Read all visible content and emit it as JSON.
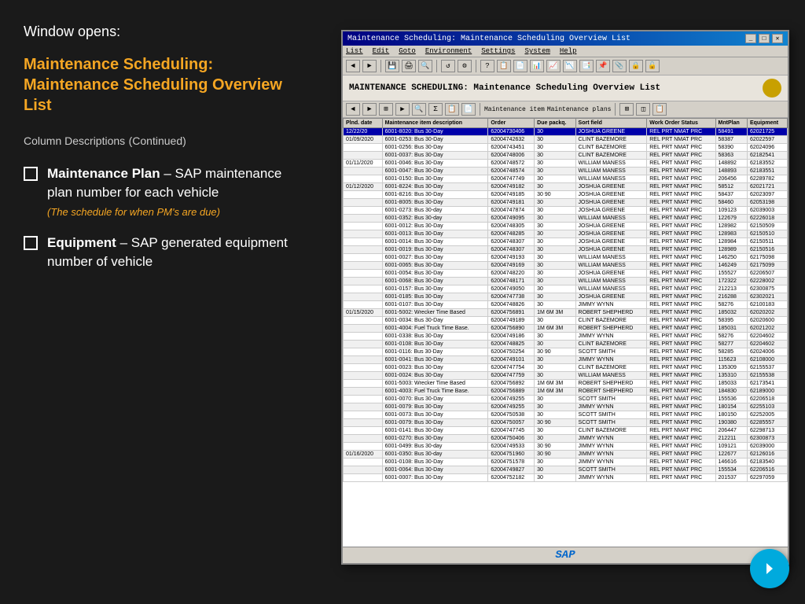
{
  "left": {
    "window_opens": "Window opens:",
    "main_title": "Maintenance Scheduling: Maintenance Scheduling Overview List",
    "column_desc": "Column Descriptions",
    "continued": "(Continued)",
    "bullets": [
      {
        "label": "Maintenance Plan",
        "desc": "SAP maintenance plan number for each vehicle",
        "sub_note": "(The schedule for when PM's are due)"
      },
      {
        "label": "Equipment",
        "desc": "SAP generated equipment number of vehicle",
        "sub_note": ""
      }
    ]
  },
  "sap": {
    "title": "Maintenance Scheduling: Maintenance Scheduling Overview List",
    "menu": [
      "List",
      "Edit",
      "Goto",
      "Environment",
      "Settings",
      "System",
      "Help"
    ],
    "content_title": "MAINTENANCE SCHEDULING: Maintenance Scheduling Overview List",
    "sub_toolbar_labels": [
      "Maintenance item",
      "Maintenance plans"
    ],
    "table_headers": [
      "Plnd. date",
      "Maintenance item description",
      "Order",
      "Due packq.",
      "Sort field",
      "Work Order Status",
      "MntPlan",
      "Equipment"
    ],
    "rows": [
      {
        "date": "12/22/20",
        "item": "6001-8020: Bus 30-Day",
        "order": "62004730406",
        "due": "30",
        "sort": "JOSHUA GREENE",
        "status": "REL PRT NMAT PRC",
        "plan": "58491",
        "equip": "62021725",
        "highlight": true
      },
      {
        "date": "01/09/2020",
        "item": "6001-0253: Bus 30-Day",
        "order": "62004742632",
        "due": "30",
        "sort": "CLINT BAZEMORE",
        "status": "REL PRT NMAT PRC",
        "plan": "58387",
        "equip": "62022597"
      },
      {
        "date": "",
        "item": "6001-0256: Bus 30-Day",
        "order": "62004743451",
        "due": "30",
        "sort": "CLINT BAZEMORE",
        "status": "REL PRT NMAT PRC",
        "plan": "58390",
        "equip": "62024096"
      },
      {
        "date": "",
        "item": "6001-0037: Bus 30-Day",
        "order": "62004748006",
        "due": "30",
        "sort": "CLINT BAZEMORE",
        "status": "REL PRT NMAT PRC",
        "plan": "58363",
        "equip": "62182541"
      },
      {
        "date": "01/11/2020",
        "item": "6001-0046: Bus 30-Day",
        "order": "62004748572",
        "due": "30",
        "sort": "WILLIAM MANESS",
        "status": "REL PRT NMAT PRC",
        "plan": "148892",
        "equip": "62183552"
      },
      {
        "date": "",
        "item": "6001-0047: Bus 30-Day",
        "order": "62004748574",
        "due": "30",
        "sort": "WILLIAM MANESS",
        "status": "REL PRT NMAT PRC",
        "plan": "148893",
        "equip": "62183551"
      },
      {
        "date": "",
        "item": "6001-0150: Bus 30-Day",
        "order": "62004747749",
        "due": "30",
        "sort": "WILLIAM MANESS",
        "status": "REL PRT NMAT PRC",
        "plan": "206456",
        "equip": "62289782"
      },
      {
        "date": "01/12/2020",
        "item": "6001-8224: Bus 30-Day",
        "order": "62004749182",
        "due": "30",
        "sort": "JOSHUA GREENE",
        "status": "REL PRT NMAT PRC",
        "plan": "58512",
        "equip": "62021721"
      },
      {
        "date": "",
        "item": "6001-8216: Bus 30-Day",
        "order": "62004749185",
        "due": "30 90",
        "sort": "JOSHUA GREENE",
        "status": "REL PRT NMAT PRC",
        "plan": "58437",
        "equip": "62023097"
      },
      {
        "date": "",
        "item": "6001-8005: Bus 30-Day",
        "order": "62004749181",
        "due": "30",
        "sort": "JOSHUA GREENE",
        "status": "REL PRT NMAT PRC",
        "plan": "58460",
        "equip": "62053198"
      },
      {
        "date": "",
        "item": "6001-0273: Bus 30-day",
        "order": "62004747874",
        "due": "30",
        "sort": "JOSHUA GREENE",
        "status": "REL PRT NMAT PRC",
        "plan": "109123",
        "equip": "62039003"
      },
      {
        "date": "",
        "item": "6001-0352: Bus 30-day",
        "order": "62004749095",
        "due": "30",
        "sort": "WILLIAM MANESS",
        "status": "REL PRT NMAT PRC",
        "plan": "122679",
        "equip": "62226018"
      },
      {
        "date": "",
        "item": "6001-0012: Bus 30-Day",
        "order": "62004748305",
        "due": "30",
        "sort": "JOSHUA GREENE",
        "status": "REL PRT NMAT PRC",
        "plan": "128982",
        "equip": "62150509"
      },
      {
        "date": "",
        "item": "6001-0013: Bus 30-Day",
        "order": "62004748285",
        "due": "30",
        "sort": "JOSHUA GREENE",
        "status": "REL PRT NMAT PRC",
        "plan": "128983",
        "equip": "62150510"
      },
      {
        "date": "",
        "item": "6001-0014: Bus 30-Day",
        "order": "62004748307",
        "due": "30",
        "sort": "JOSHUA GREENE",
        "status": "REL PRT NMAT PRC",
        "plan": "128984",
        "equip": "62150511"
      },
      {
        "date": "",
        "item": "6001-0019: Bus 30-Day",
        "order": "62004748307",
        "due": "30",
        "sort": "JOSHUA GREENE",
        "status": "REL PRT NMAT PRC",
        "plan": "128989",
        "equip": "62150516"
      },
      {
        "date": "",
        "item": "6001-0027: Bus 30-Day",
        "order": "62004749193",
        "due": "30",
        "sort": "WILLIAM MANESS",
        "status": "REL PRT NMAT PRC",
        "plan": "146250",
        "equip": "62175098"
      },
      {
        "date": "",
        "item": "6001-0065: Bus 30-Day",
        "order": "62004749169",
        "due": "30",
        "sort": "WILLIAM MANESS",
        "status": "REL PRT NMAT PRC",
        "plan": "146249",
        "equip": "62175099"
      },
      {
        "date": "",
        "item": "6001-0054: Bus 30-Day",
        "order": "62004748220",
        "due": "30",
        "sort": "JOSHUA GREENE",
        "status": "REL PRT NMAT PRC",
        "plan": "155527",
        "equip": "62206507"
      },
      {
        "date": "",
        "item": "6001-0068: Bus 30-Day",
        "order": "62004748171",
        "due": "30",
        "sort": "WILLIAM MANESS",
        "status": "REL PRT NMAT PRC",
        "plan": "172322",
        "equip": "62228002"
      },
      {
        "date": "",
        "item": "6001-0157: Bus 30-Day",
        "order": "62004749050",
        "due": "30",
        "sort": "WILLIAM MANESS",
        "status": "REL PRT NMAT PRC",
        "plan": "212213",
        "equip": "62300875"
      },
      {
        "date": "",
        "item": "6001-0185: Bus 30-Day",
        "order": "62004747738",
        "due": "30",
        "sort": "JOSHUA GREENE",
        "status": "REL PRT NMAT PRC",
        "plan": "216288",
        "equip": "62302021"
      },
      {
        "date": "",
        "item": "6001-0107: Bus 30-Day",
        "order": "62004748826",
        "due": "30",
        "sort": "JIMMY WYNN",
        "status": "REL PRT NMAT PRC",
        "plan": "58276",
        "equip": "62100183"
      },
      {
        "date": "01/15/2020",
        "item": "6001-5002: Wrecker Time Based",
        "order": "62004756891",
        "due": "1M 6M 3M",
        "sort": "ROBERT SHEPHERD",
        "status": "REL PRT NMAT PRC",
        "plan": "185032",
        "equip": "62020202"
      },
      {
        "date": "",
        "item": "6001-0034: Bus 30-Day",
        "order": "62004749189",
        "due": "30",
        "sort": "CLINT BAZEMORE",
        "status": "REL PRT NMAT PRC",
        "plan": "58395",
        "equip": "62020600"
      },
      {
        "date": "",
        "item": "6001-4004: Fuel Truck Time Base.",
        "order": "62004756890",
        "due": "1M 6M 3M",
        "sort": "ROBERT SHEPHERD",
        "status": "REL PRT NMAT PRC",
        "plan": "185031",
        "equip": "62021202"
      },
      {
        "date": "",
        "item": "6001-0338: Bus 30-Day",
        "order": "62004749186",
        "due": "30",
        "sort": "JIMMY WYNN",
        "status": "REL PRT NMAT PRC",
        "plan": "58276",
        "equip": "62204602"
      },
      {
        "date": "",
        "item": "6001-0108: Bus 30-Day",
        "order": "62004748825",
        "due": "30",
        "sort": "CLINT BAZEMORE",
        "status": "REL PRT NMAT PRC",
        "plan": "58277",
        "equip": "62204602"
      },
      {
        "date": "",
        "item": "6001-0116: Bus 30-Day",
        "order": "62004750254",
        "due": "30 90",
        "sort": "SCOTT SMITH",
        "status": "REL PRT NMAT PRC",
        "plan": "58285",
        "equip": "62024006"
      },
      {
        "date": "",
        "item": "6001-0041: Bus 30-Day",
        "order": "62004749101",
        "due": "30",
        "sort": "JIMMY WYNN",
        "status": "REL PRT NMAT PRC",
        "plan": "115623",
        "equip": "62108000"
      },
      {
        "date": "",
        "item": "6001-0023: Bus 30-Day",
        "order": "62004747754",
        "due": "30",
        "sort": "CLINT BAZEMORE",
        "status": "REL PRT NMAT PRC",
        "plan": "135309",
        "equip": "62155537"
      },
      {
        "date": "",
        "item": "6001-0024: Bus 30-Day",
        "order": "62004747759",
        "due": "30",
        "sort": "WILLIAM MANESS",
        "status": "REL PRT NMAT PRC",
        "plan": "135310",
        "equip": "62155538"
      },
      {
        "date": "",
        "item": "6001-5003: Wrecker Time Based",
        "order": "62004756892",
        "due": "1M 6M 3M",
        "sort": "ROBERT SHEPHERD",
        "status": "REL PRT NMAT PRC",
        "plan": "185033",
        "equip": "62173541"
      },
      {
        "date": "",
        "item": "6001-4003: Fuel Truck Time Base.",
        "order": "62004756889",
        "due": "1M 6M 3M",
        "sort": "ROBERT SHEPHERD",
        "status": "REL PRT NMAT PRC",
        "plan": "184830",
        "equip": "62189000"
      },
      {
        "date": "",
        "item": "6001-0070: Bus 30-Day",
        "order": "62004749255",
        "due": "30",
        "sort": "SCOTT SMITH",
        "status": "REL PRT NMAT PRC",
        "plan": "155536",
        "equip": "62206518"
      },
      {
        "date": "",
        "item": "6001-0079: Bus 30-Day",
        "order": "62004749255",
        "due": "30",
        "sort": "JIMMY WYNN",
        "status": "REL PRT NMAT PRC",
        "plan": "180154",
        "equip": "62255103"
      },
      {
        "date": "",
        "item": "6001-0073: Bus 30-Day",
        "order": "62004750538",
        "due": "30",
        "sort": "SCOTT SMITH",
        "status": "REL PRT NMAT PRC",
        "plan": "180150",
        "equip": "62252005"
      },
      {
        "date": "",
        "item": "6001-0079: Bus 30-Day",
        "order": "62004750057",
        "due": "30 90",
        "sort": "SCOTT SMITH",
        "status": "REL PRT NMAT PRC",
        "plan": "190380",
        "equip": "62285557"
      },
      {
        "date": "",
        "item": "6001-0141: Bus 30-Day",
        "order": "62004747745",
        "due": "30",
        "sort": "CLINT BAZEMORE",
        "status": "REL PRT NMAT PRC",
        "plan": "206447",
        "equip": "62298713"
      },
      {
        "date": "",
        "item": "6001-0270: Bus 30-Day",
        "order": "62004750406",
        "due": "30",
        "sort": "JIMMY WYNN",
        "status": "REL PRT NMAT PRC",
        "plan": "212211",
        "equip": "62300873"
      },
      {
        "date": "",
        "item": "6001-0499: Bus 30-day",
        "order": "62004749533",
        "due": "30 90",
        "sort": "JIMMY WYNN",
        "status": "REL PRT NMAT PRC",
        "plan": "109121",
        "equip": "62039000"
      },
      {
        "date": "01/16/2020",
        "item": "6001-0350: Bus 30-day",
        "order": "62004751960",
        "due": "30 90",
        "sort": "JIMMY WYNN",
        "status": "REL PRT NMAT PRC",
        "plan": "122677",
        "equip": "62126016"
      },
      {
        "date": "",
        "item": "6001-0108: Bus 30-Day",
        "order": "62004751578",
        "due": "30",
        "sort": "JIMMY WYNN",
        "status": "REL PRT NMAT PRC",
        "plan": "146616",
        "equip": "62183540"
      },
      {
        "date": "",
        "item": "6001-0064: Bus 30-Day",
        "order": "62004749827",
        "due": "30",
        "sort": "SCOTT SMITH",
        "status": "REL PRT NMAT PRC",
        "plan": "155534",
        "equip": "62206516"
      },
      {
        "date": "",
        "item": "6001-0007: Bus 30-Day",
        "order": "62004752182",
        "due": "30",
        "sort": "JIMMY WYNN",
        "status": "REL PRT NMAT PRC",
        "plan": "201537",
        "equip": "62297059"
      }
    ]
  },
  "nav": {
    "arrow": "→"
  }
}
